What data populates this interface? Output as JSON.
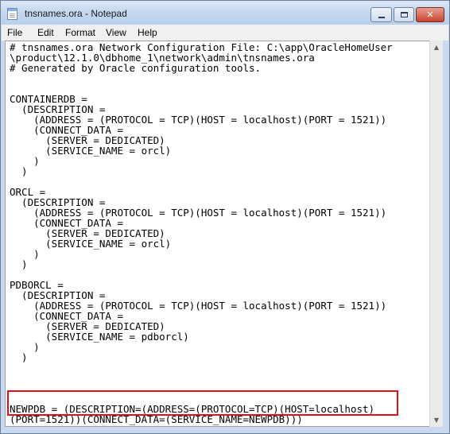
{
  "window": {
    "title": "tnsnames.ora - Notepad",
    "controls": {
      "minimize": "minimize",
      "maximize": "maximize",
      "close": "✕"
    }
  },
  "menu": {
    "items": [
      "File",
      "Edit",
      "Format",
      "View",
      "Help"
    ]
  },
  "editor": {
    "lines": [
      "# tnsnames.ora Network Configuration File: C:\\app\\OracleHomeUser",
      "\\product\\12.1.0\\dbhome_1\\network\\admin\\tnsnames.ora",
      "# Generated by Oracle configuration tools.",
      "",
      "",
      "CONTAINERDB =",
      "  (DESCRIPTION =",
      "    (ADDRESS = (PROTOCOL = TCP)(HOST = localhost)(PORT = 1521))",
      "    (CONNECT_DATA =",
      "      (SERVER = DEDICATED)",
      "      (SERVICE_NAME = orcl)",
      "    )",
      "  )",
      "",
      "ORCL =",
      "  (DESCRIPTION =",
      "    (ADDRESS = (PROTOCOL = TCP)(HOST = localhost)(PORT = 1521))",
      "    (CONNECT_DATA =",
      "      (SERVER = DEDICATED)",
      "      (SERVICE_NAME = orcl)",
      "    )",
      "  )",
      "",
      "PDBORCL =",
      "  (DESCRIPTION =",
      "    (ADDRESS = (PROTOCOL = TCP)(HOST = localhost)(PORT = 1521))",
      "    (CONNECT_DATA =",
      "      (SERVER = DEDICATED)",
      "      (SERVICE_NAME = pdborcl)",
      "    )",
      "  )",
      "",
      "",
      "",
      "",
      "NEWPDB = (DESCRIPTION=(ADDRESS=(PROTOCOL=TCP)(HOST=localhost)",
      "(PORT=1521))(CONNECT_DATA=(SERVICE_NAME=NEWPDB)))"
    ],
    "highlight_color": "#e0101a"
  }
}
